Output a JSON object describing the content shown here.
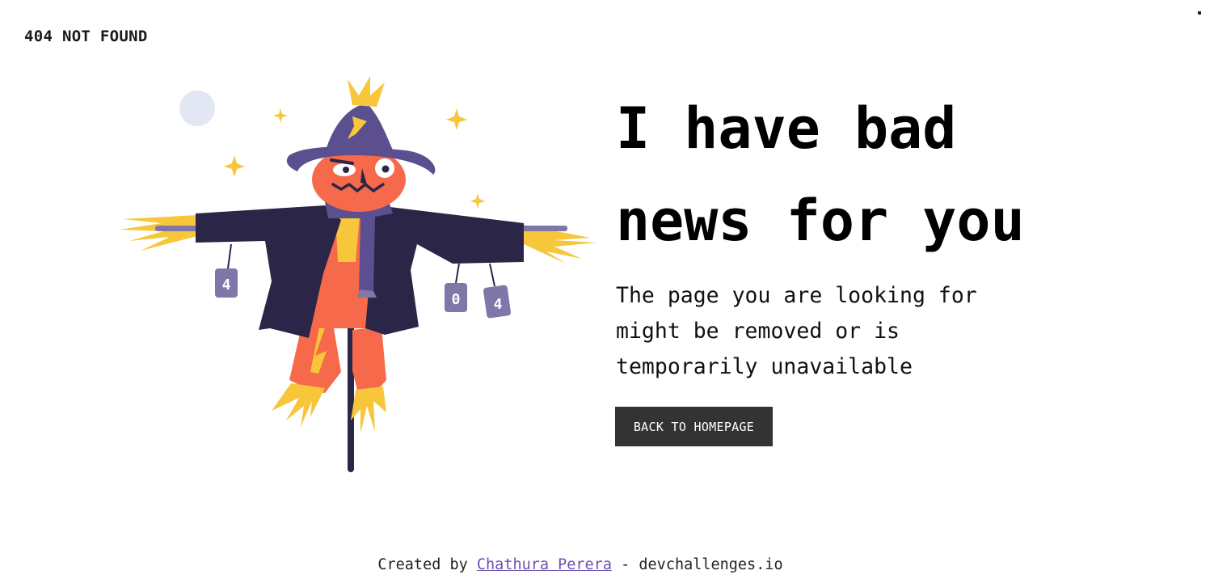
{
  "header": {
    "brand": "404 NOT FOUND"
  },
  "illustration": {
    "icon": "scarecrow-illustration",
    "can_labels": [
      "4",
      "0",
      "4"
    ]
  },
  "main": {
    "headline_line1": "I have bad",
    "headline_line2": "news for you",
    "description_line1": "The page you are looking for",
    "description_line2": "might be removed or is",
    "description_line3": "temporarily unavailable",
    "button_label": "BACK TO HOMEPAGE"
  },
  "footer": {
    "prefix": "Created by",
    "author": "Chathura Perera",
    "suffix": "- devchallenges.io"
  },
  "colors": {
    "background": "#ffffff",
    "text": "#000000",
    "button_bg": "#333333",
    "button_text": "#ffffff",
    "link": "#6f4fb0",
    "hat": "#5b4f8f",
    "coat": "#2b2548",
    "face": "#f66a4b",
    "straw": "#f8c63a"
  }
}
